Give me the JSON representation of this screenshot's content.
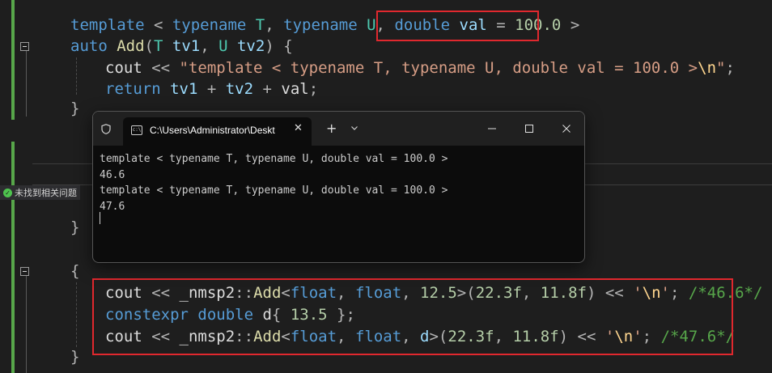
{
  "editor": {
    "lines": [
      {
        "tokens": [
          [
            "kw",
            "template"
          ],
          [
            "op",
            " < "
          ],
          [
            "kw",
            "typename"
          ],
          [
            "tp",
            " T"
          ],
          [
            "op",
            ", "
          ],
          [
            "kw",
            "typename"
          ],
          [
            "tp",
            " U"
          ],
          [
            "op",
            ", "
          ],
          [
            "kw",
            "double"
          ],
          [
            "pn",
            " val"
          ],
          [
            "op",
            " = "
          ],
          [
            "nm",
            "100.0"
          ],
          [
            "op",
            " >"
          ]
        ]
      },
      {
        "tokens": [
          [
            "kw",
            "auto"
          ],
          [
            "fn",
            " Add"
          ],
          [
            "op",
            "("
          ],
          [
            "tp",
            "T"
          ],
          [
            "pn",
            " tv1"
          ],
          [
            "op",
            ", "
          ],
          [
            "tp",
            "U"
          ],
          [
            "pn",
            " tv2"
          ],
          [
            "op",
            ") {"
          ]
        ]
      },
      {
        "tokens": [
          [
            "id",
            "cout"
          ],
          [
            "op",
            " << "
          ],
          [
            "st",
            "\"template < typename T, typename U, double val = 100.0 >"
          ],
          [
            "es",
            "\\n"
          ],
          [
            "st",
            "\""
          ],
          [
            "op",
            ";"
          ]
        ]
      },
      {
        "tokens": [
          [
            "kw",
            "return"
          ],
          [
            "pn",
            " tv1"
          ],
          [
            "op",
            " + "
          ],
          [
            "pn",
            "tv2"
          ],
          [
            "op",
            " + "
          ],
          [
            "id",
            "val"
          ],
          [
            "op",
            ";"
          ]
        ]
      },
      {
        "tokens": [
          [
            "op",
            "}"
          ]
        ]
      },
      {
        "tokens": [
          [
            "op",
            "}"
          ]
        ]
      },
      {
        "tokens": [
          [
            "op",
            "{"
          ]
        ]
      },
      {
        "tokens": [
          [
            "id",
            "cout"
          ],
          [
            "op",
            " << "
          ],
          [
            "id",
            "_nmsp2"
          ],
          [
            "op",
            "::"
          ],
          [
            "fn",
            "Add"
          ],
          [
            "op",
            "<"
          ],
          [
            "kw",
            "float"
          ],
          [
            "op",
            ", "
          ],
          [
            "kw",
            "float"
          ],
          [
            "op",
            ", "
          ],
          [
            "nm",
            "12.5"
          ],
          [
            "op",
            ">("
          ],
          [
            "nm",
            "22.3f"
          ],
          [
            "op",
            ", "
          ],
          [
            "nm",
            "11.8f"
          ],
          [
            "op",
            ") << "
          ],
          [
            "st",
            "'"
          ],
          [
            "es",
            "\\n"
          ],
          [
            "st",
            "'"
          ],
          [
            "op",
            "; "
          ],
          [
            "cm",
            "/*46.6*/"
          ]
        ]
      },
      {
        "tokens": [
          [
            "kw",
            "constexpr"
          ],
          [
            "kw",
            " double"
          ],
          [
            "id",
            " d"
          ],
          [
            "op",
            "{ "
          ],
          [
            "nm",
            "13.5"
          ],
          [
            "op",
            " };"
          ]
        ]
      },
      {
        "tokens": [
          [
            "id",
            "cout"
          ],
          [
            "op",
            " << "
          ],
          [
            "id",
            "_nmsp2"
          ],
          [
            "op",
            "::"
          ],
          [
            "fn",
            "Add"
          ],
          [
            "op",
            "<"
          ],
          [
            "kw",
            "float"
          ],
          [
            "op",
            ", "
          ],
          [
            "kw",
            "float"
          ],
          [
            "op",
            ", "
          ],
          [
            "pn",
            "d"
          ],
          [
            "op",
            ">("
          ],
          [
            "nm",
            "22.3f"
          ],
          [
            "op",
            ", "
          ],
          [
            "nm",
            "11.8f"
          ],
          [
            "op",
            ") << "
          ],
          [
            "st",
            "'"
          ],
          [
            "es",
            "\\n"
          ],
          [
            "st",
            "'"
          ],
          [
            "op",
            "; "
          ],
          [
            "cm",
            "/*47.6*/"
          ]
        ]
      },
      {
        "tokens": [
          [
            "op",
            "}"
          ]
        ]
      }
    ]
  },
  "status": {
    "issues_label": "未找到相关问题"
  },
  "terminal": {
    "tab_title": "C:\\Users\\Administrator\\Deskt",
    "tab_icon_text": "c:\\",
    "output": [
      "template < typename T, typename U, double val = 100.0 >",
      "46.6",
      "template < typename T, typename U, double val = 100.0 >",
      "47.6"
    ],
    "icons": {
      "shield": "shield-icon",
      "close": "close-icon",
      "new_tab": "plus-icon",
      "dropdown": "chevron-down-icon",
      "minimize": "minimize-icon",
      "maximize": "maximize-icon",
      "window_close": "close-icon"
    }
  },
  "colors": {
    "highlight_box": "#e0282e",
    "editor_bg": "#1e1e1e",
    "terminal_bg": "#0c0c0c",
    "change_bar": "#57a64a"
  }
}
